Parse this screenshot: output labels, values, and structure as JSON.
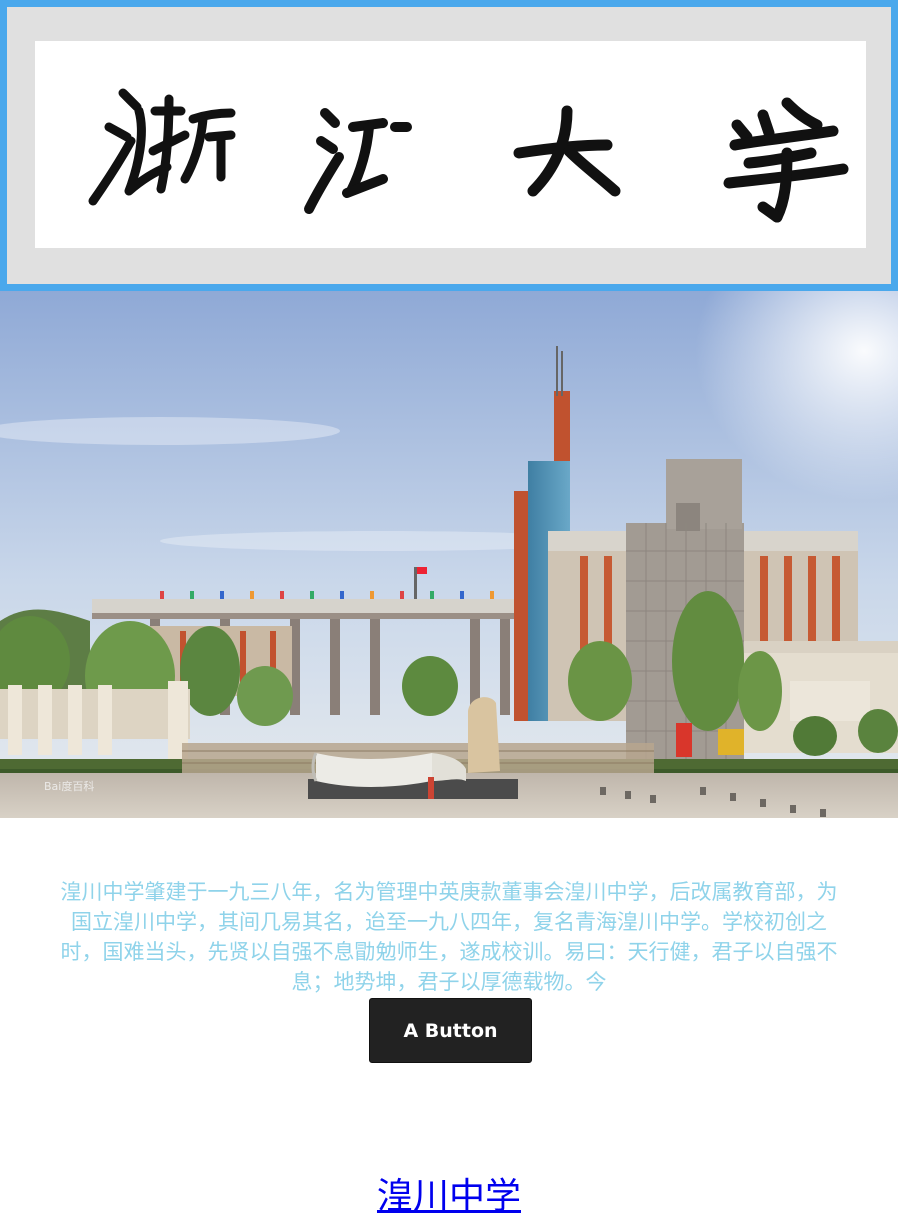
{
  "header": {
    "logo_calligraphy": "浙江大学",
    "border_color": "#4aa8ec",
    "background_color": "#e0e0e0"
  },
  "hero_image": {
    "watermark": "Bai度百科"
  },
  "content": {
    "intro_text": "湟川中学肇建于一九三八年，名为管理中英庚款董事会湟川中学，后改属教育部，为国立湟川中学，其间几易其名，迨至一九八四年，复名青海湟川中学。学校初创之时，国难当头，先贤以自强不息勖勉师生，遂成校训。易曰：天行健，君子以自强不息；地势坤，君子以厚德载物。今",
    "text_color": "#8fd3ea",
    "button_label": "A Button",
    "link_text": "湟川中学",
    "link_color": "#0000ee"
  }
}
